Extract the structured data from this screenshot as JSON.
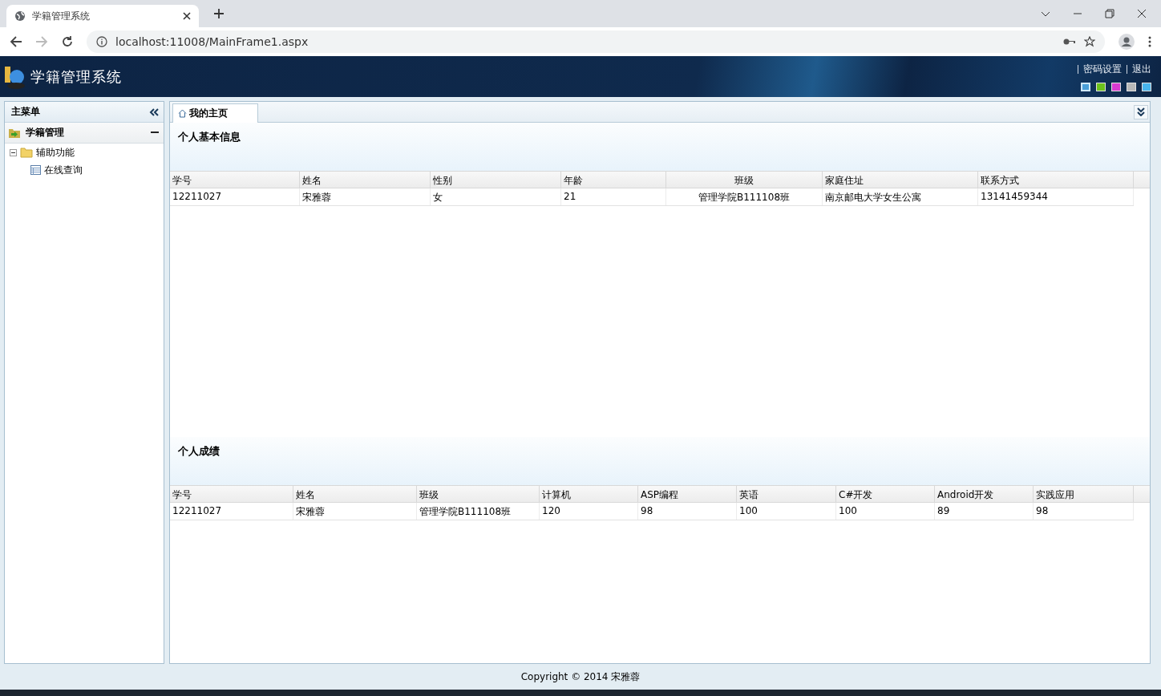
{
  "browser": {
    "tab_title": "学籍管理系统",
    "url": "localhost:11008/MainFrame1.aspx"
  },
  "header": {
    "title": "学籍管理系统",
    "links": [
      "密码设置",
      "退出"
    ],
    "themes": [
      {
        "color": "#4a9fd8",
        "selected": true
      },
      {
        "color": "#6cc21c",
        "selected": false
      },
      {
        "color": "#d83ad0",
        "selected": false
      },
      {
        "color": "#b8b8b8",
        "selected": false
      },
      {
        "color": "#48b4ec",
        "selected": false
      }
    ]
  },
  "sidebar": {
    "title": "主菜单",
    "group": "学籍管理",
    "tree": [
      {
        "label": "辅助功能",
        "expanded": true,
        "children": [
          {
            "label": "在线查询"
          }
        ]
      }
    ]
  },
  "tabs": [
    {
      "label": "我的主页",
      "selected": true
    }
  ],
  "sections": [
    {
      "title": "个人基本信息",
      "columns": [
        {
          "label": "学号"
        },
        {
          "label": "姓名"
        },
        {
          "label": "性别"
        },
        {
          "label": "年龄"
        },
        {
          "label": "班级",
          "centered": true
        },
        {
          "label": "家庭住址"
        },
        {
          "label": "联系方式"
        }
      ],
      "rows": [
        [
          "12211027",
          "宋雅蓉",
          "女",
          "21",
          "管理学院B111108班",
          "南京邮电大学女生公寓",
          "13141459344"
        ]
      ]
    },
    {
      "title": "个人成绩",
      "columns": [
        {
          "label": "学号"
        },
        {
          "label": "姓名"
        },
        {
          "label": "班级"
        },
        {
          "label": "计算机"
        },
        {
          "label": "ASP编程"
        },
        {
          "label": "英语"
        },
        {
          "label": "C#开发"
        },
        {
          "label": "Android开发"
        },
        {
          "label": "实践应用"
        }
      ],
      "rows": [
        [
          "12211027",
          "宋雅蓉",
          "管理学院B111108班",
          "120",
          "98",
          "100",
          "100",
          "89",
          "98"
        ]
      ]
    }
  ],
  "footer": "Copyright © 2014 宋雅蓉"
}
